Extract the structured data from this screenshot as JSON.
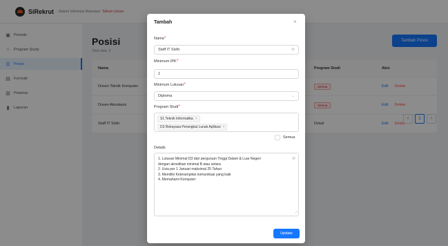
{
  "header": {
    "brand": "SiRekrut",
    "subtitle": "- Sistem Informasi Rekrutasi",
    "org": "Telkom Univer"
  },
  "sidebar": {
    "items": [
      {
        "label": "Periode",
        "icon": "calendar-icon"
      },
      {
        "label": "Program Study",
        "icon": "graduation-icon"
      },
      {
        "label": "Posisi",
        "icon": "list-icon"
      },
      {
        "label": "Formulir",
        "icon": "form-icon"
      },
      {
        "label": "Pelamar",
        "icon": "user-icon"
      },
      {
        "label": "Laporan",
        "icon": "chart-icon"
      }
    ],
    "active": "Posisi"
  },
  "page": {
    "title": "Posisi",
    "total": "Total data: 3",
    "add_button": "Tambah Posisi"
  },
  "table": {
    "headers": [
      "Nama",
      "Program Studi",
      "Aksi"
    ],
    "rows": [
      {
        "nama": "Dosen Teknik Komputer",
        "program_studi": "Semua",
        "edit": "Edit",
        "delete": "Delete"
      },
      {
        "nama": "Dosen Akuntansi",
        "program_studi": "Semua",
        "edit": "Edit",
        "delete": "Delete"
      },
      {
        "nama": "Staff IT Sisfo",
        "program_studi": "Detail",
        "edit": "Edit",
        "delete": "Delete"
      }
    ]
  },
  "pagination": {
    "prev": "<",
    "current": "1",
    "next": ">"
  },
  "modal": {
    "title": "Tambah",
    "close": "×",
    "nama": {
      "label": "Nama",
      "value": "Staff IT Sisfo"
    },
    "ipk": {
      "label": "Minimum IPK",
      "value": "1"
    },
    "lulusan": {
      "label": "Minimum Lulusan",
      "value": "Diploma"
    },
    "prodi": {
      "label": "Program Studi",
      "tags": [
        "S1 Teknik Informatika",
        "D3 Rekayasa Perangkat Lunak Aplikasi"
      ]
    },
    "semua": "Semua",
    "details": {
      "label": "Details",
      "lines": [
        "1. Lulusan Minimal D3 dari perguruan Tinggi Dalam & Luar Negeri",
        "dengan akreditasi minimal B atau setara",
        "2. Usia per 1 Januari maksimal 25 Tahun",
        "3. Memiliki Keterampilan komunikasi yang baik",
        "4. Memahami Komputer"
      ]
    },
    "update_button": "Update"
  },
  "colors": {
    "primary": "#1677ff",
    "danger": "#ff4d4f",
    "overlay": "rgba(0,0,0,0.45)"
  }
}
